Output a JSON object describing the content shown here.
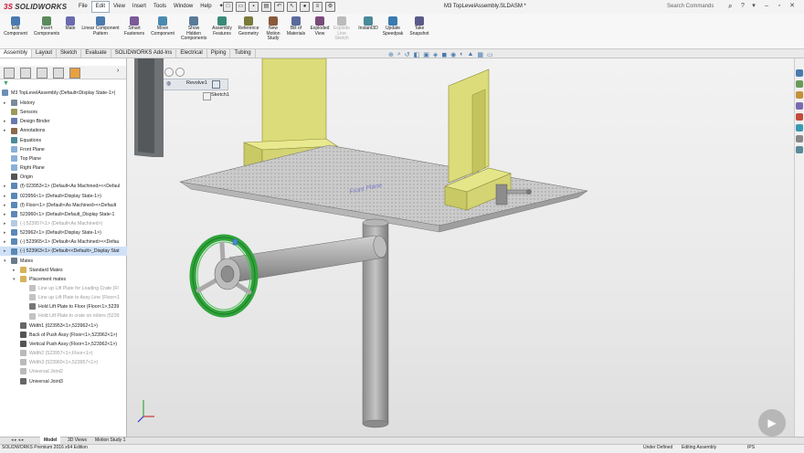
{
  "app": {
    "logo_ds": "3S",
    "logo_name": "SOLIDWORKS",
    "menus": [
      "File",
      "Edit",
      "View",
      "Insert",
      "Tools",
      "Window",
      "Help"
    ],
    "active_menu": "Edit",
    "document_title": "M3 TopLevelAssembly.SLDASM *",
    "search_placeholder": "Search Commands"
  },
  "commands": [
    {
      "label": "Edit\nComponent",
      "icon": "edit-component-icon"
    },
    {
      "label": "Insert\nComponents",
      "icon": "insert-components-icon"
    },
    {
      "label": "Mate",
      "icon": "mate-icon"
    },
    {
      "label": "Linear Component\nPattern",
      "icon": "linear-pattern-icon"
    },
    {
      "label": "Smart\nFasteners",
      "icon": "smart-fasteners-icon"
    },
    {
      "label": "Move\nComponent",
      "icon": "move-component-icon"
    },
    {
      "label": "Show\nHidden\nComponents",
      "icon": "show-hidden-icon"
    },
    {
      "label": "Assembly\nFeatures",
      "icon": "assembly-features-icon"
    },
    {
      "label": "Reference\nGeometry",
      "icon": "reference-geometry-icon"
    },
    {
      "label": "New\nMotion\nStudy",
      "icon": "motion-study-icon"
    },
    {
      "label": "Bill of\nMaterials",
      "icon": "bom-icon"
    },
    {
      "label": "Exploded\nView",
      "icon": "exploded-view-icon"
    },
    {
      "label": "Explode\nLine\nSketch",
      "icon": "explode-line-icon",
      "disabled": true
    },
    {
      "label": "Instant3D",
      "icon": "instant3d-icon"
    },
    {
      "label": "Update\nSpeedpak",
      "icon": "speedpak-icon"
    },
    {
      "label": "Take\nSnapshot",
      "icon": "snapshot-icon"
    }
  ],
  "command_tabs": [
    "Assembly",
    "Layout",
    "Sketch",
    "Evaluate",
    "SOLIDWORKS Add-Ins",
    "Electrical",
    "Piping",
    "Tubing"
  ],
  "active_command_tab": "Assembly",
  "tree": {
    "root": "M3 TopLevelAssembly (Default<Display State-1>)",
    "items": [
      {
        "label": "History",
        "icon": "history-icon",
        "expand": true
      },
      {
        "label": "Sensors",
        "icon": "sensors-icon"
      },
      {
        "label": "Design Binder",
        "icon": "binder-icon",
        "expand": true
      },
      {
        "label": "Annotations",
        "icon": "annotations-icon",
        "expand": true
      },
      {
        "label": "Equations",
        "icon": "equations-icon"
      },
      {
        "label": "Front Plane",
        "icon": "plane-icon"
      },
      {
        "label": "Top Plane",
        "icon": "plane-icon"
      },
      {
        "label": "Right Plane",
        "icon": "plane-icon"
      },
      {
        "label": "Origin",
        "icon": "origin-icon"
      },
      {
        "label": "(f) 023953<1> (Default<As Machined><<Defaul",
        "icon": "part-icon",
        "expand": true
      },
      {
        "label": "023956<1> (Default<Display State-1>)",
        "icon": "part-icon",
        "expand": true
      },
      {
        "label": "(f) Floor<1> (Default<As Machined><<Default",
        "icon": "part-icon",
        "expand": true
      },
      {
        "label": "523960<1> (Default<Default_Display State-1",
        "icon": "part-icon",
        "expand": true
      },
      {
        "label": "(-) 523957<1> (Default<As Machined>)",
        "icon": "part-icon",
        "dim": true,
        "expand": true
      },
      {
        "label": "523962<1> (Default<Display State-1>)",
        "icon": "part-icon",
        "expand": true
      },
      {
        "label": "(-) 523965<1> (Default<As Machined><<Defau",
        "icon": "part-icon",
        "expand": true
      },
      {
        "label": "(-) 523963<1> (Default<<Default>_Display Stat",
        "icon": "part-icon",
        "selected": true,
        "expand": true
      },
      {
        "label": "Mates",
        "icon": "mates-icon",
        "open": true
      },
      {
        "label": "Standard Mates",
        "icon": "folder-icon",
        "indent": 1,
        "expand": true
      },
      {
        "label": "Placement mates",
        "icon": "folder-icon",
        "indent": 1,
        "open": true
      },
      {
        "label": "Line up Lift Plate for Loading Crate (Fl",
        "icon": "mate-item-icon",
        "indent": 2,
        "dim": true
      },
      {
        "label": "Line up Lift Plate to Assy Line (Floor<1",
        "icon": "mate-item-icon",
        "indent": 2,
        "dim": true
      },
      {
        "label": "Hold Lift Plate to Floor (Floor<1>,5239",
        "icon": "mate-item-icon",
        "indent": 2
      },
      {
        "label": "Hold Lift Plate to crate on rollers (5239",
        "icon": "mate-item-icon",
        "indent": 2,
        "dim": true
      },
      {
        "label": "Width1 (023953<1>,523962<1>)",
        "icon": "width-mate-icon",
        "indent": 1
      },
      {
        "label": "Back of Push Assy (Floor<1>,523962<1>)",
        "icon": "distance-mate-icon",
        "indent": 1
      },
      {
        "label": "Vertical Push Assy (Floor<1>,523962<1>)",
        "icon": "distance-mate-icon",
        "indent": 1
      },
      {
        "label": "Width2 (523957<1>,Floor<1>)",
        "icon": "width-mate-icon",
        "indent": 1,
        "dim": true
      },
      {
        "label": "Width3 (523960<1>,523957<1>)",
        "icon": "width-mate-icon",
        "indent": 1,
        "dim": true
      },
      {
        "label": "Universal Joint2",
        "icon": "universal-joint-icon",
        "indent": 1,
        "dim": true
      },
      {
        "label": "Universal Joint3",
        "icon": "universal-joint-icon",
        "indent": 1
      }
    ]
  },
  "context": {
    "feature": "Revolve1",
    "sketch": "Sketch1"
  },
  "model": {
    "table_text": "Front Plane"
  },
  "bottom_tabs": [
    "Model",
    "3D Views",
    "Motion Study 1"
  ],
  "active_bottom_tab": "Model",
  "status": {
    "product": "SOLIDWORKS Premium 2016 x64 Edition",
    "definition": "Under Defined",
    "mode": "Editing Assembly",
    "units": "IPS"
  },
  "colors": {
    "accent": "#c8102e",
    "plate_yellow": "#dcdc7a",
    "handwheel_green": "#2fa43a",
    "shaft_gray": "#a6a6a6",
    "table_gray": "#d4d4d4"
  }
}
